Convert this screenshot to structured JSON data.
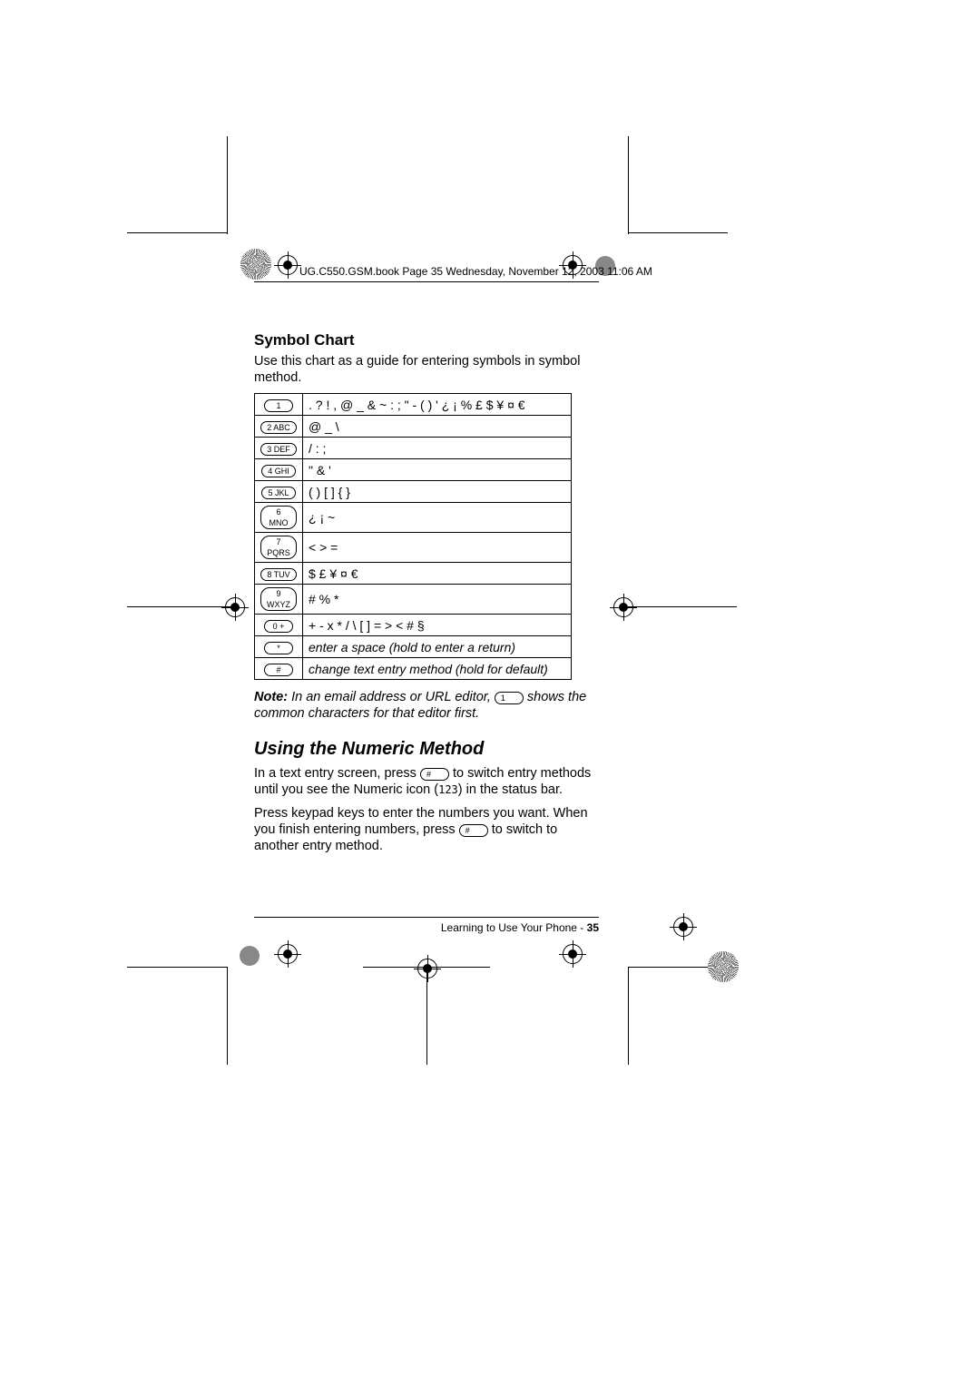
{
  "header": {
    "text": "UG.C550.GSM.book  Page 35  Wednesday, November 12, 2003  11:06 AM"
  },
  "section1": {
    "title": "Symbol Chart",
    "intro": "Use this chart as a guide for entering symbols in symbol method."
  },
  "chart_data": {
    "type": "table",
    "rows": [
      {
        "key": "1",
        "symbols": ". ? ! , @ _ & ~ : ; \" - ( ) ' ¿ ¡ % £ $ ¥ ¤ €"
      },
      {
        "key": "2 ABC",
        "symbols": "@ _ \\"
      },
      {
        "key": "3 DEF",
        "symbols": "/ : ;"
      },
      {
        "key": "4 GHI",
        "symbols": "\" & '"
      },
      {
        "key": "5 JKL",
        "symbols": "( ) [ ] { }"
      },
      {
        "key": "6 MNO",
        "symbols": "¿ ¡ ~"
      },
      {
        "key": "7 PQRS",
        "symbols": "< > ="
      },
      {
        "key": "8 TUV",
        "symbols": "$ £ ¥ ¤ €"
      },
      {
        "key": "9 WXYZ",
        "symbols": "# % *"
      },
      {
        "key": "0 +",
        "symbols": "+ - x * / \\ [ ] = > < # §"
      },
      {
        "key": "*",
        "symbols": "enter a space (hold to enter a return)"
      },
      {
        "key": "#",
        "symbols": "change text entry method (hold for default)"
      }
    ]
  },
  "note": {
    "label": "Note:",
    "before": " In an email address or URL editor, ",
    "keyref": "1",
    "after": " shows the common characters for that editor first."
  },
  "section2": {
    "title": "Using the Numeric Method",
    "p1a": "In a text entry screen, press ",
    "p1key": "#",
    "p1b": " to switch entry methods until you see the Numeric icon (",
    "p1icon": "123",
    "p1c": ") in the status bar.",
    "p2a": "Press keypad keys to enter the numbers you want. When you finish entering numbers, press ",
    "p2key": "#",
    "p2b": " to switch to another entry method."
  },
  "footer": {
    "text": "Learning to Use Your Phone - ",
    "page": "35"
  }
}
